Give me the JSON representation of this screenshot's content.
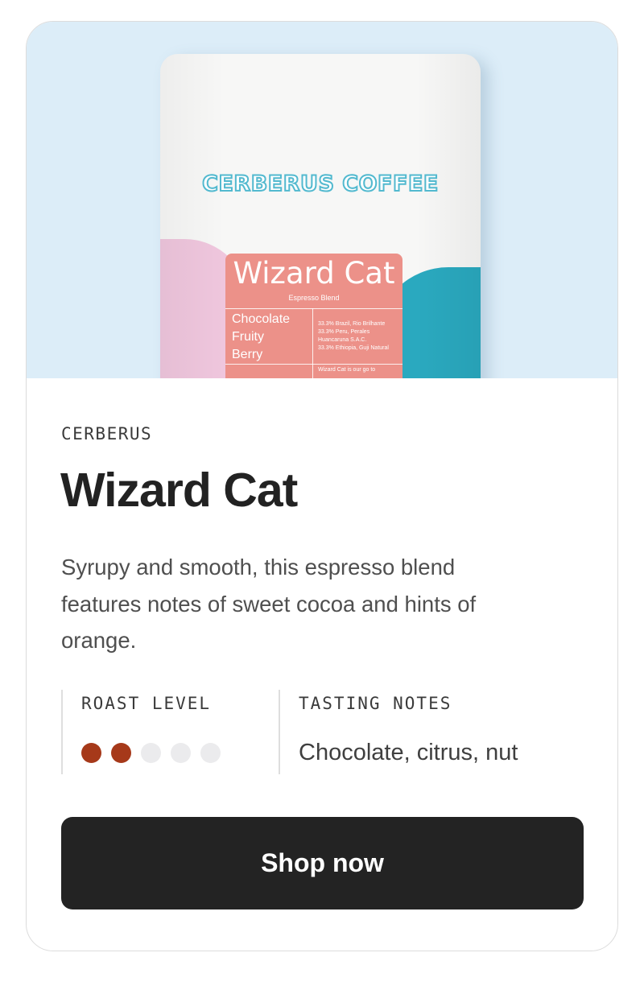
{
  "hero": {
    "bag": {
      "brand_logo": "CERBERUS COFFEE",
      "label_name": "Wizard Cat",
      "label_subtitle": "Espresso Blend",
      "label_notes": [
        "Chocolate",
        "Fruity",
        "Berry"
      ],
      "label_origins": [
        "33.3% Brazil, Rio Brilhante",
        "33.3% Peru, Perales Huancaruna S.A.C.",
        "33.3% Ethiopia, Guji Natural"
      ],
      "label_footer": "Wizard Cat is our go to"
    },
    "background_color": "#dcedf8"
  },
  "product": {
    "roaster": "CERBERUS",
    "title": "Wizard Cat",
    "description": "Syrupy and smooth, this espresso blend features notes of sweet cocoa and hints of orange."
  },
  "attributes": {
    "roast_level_label": "ROAST LEVEL",
    "roast_level": 2,
    "roast_level_max": 5,
    "tasting_notes_label": "TASTING NOTES",
    "tasting_notes": "Chocolate, citrus, nut"
  },
  "colors": {
    "roast_filled": "#a6391a",
    "roast_empty": "#ebebed",
    "button_bg": "#232323"
  },
  "cta": {
    "label": "Shop now"
  }
}
